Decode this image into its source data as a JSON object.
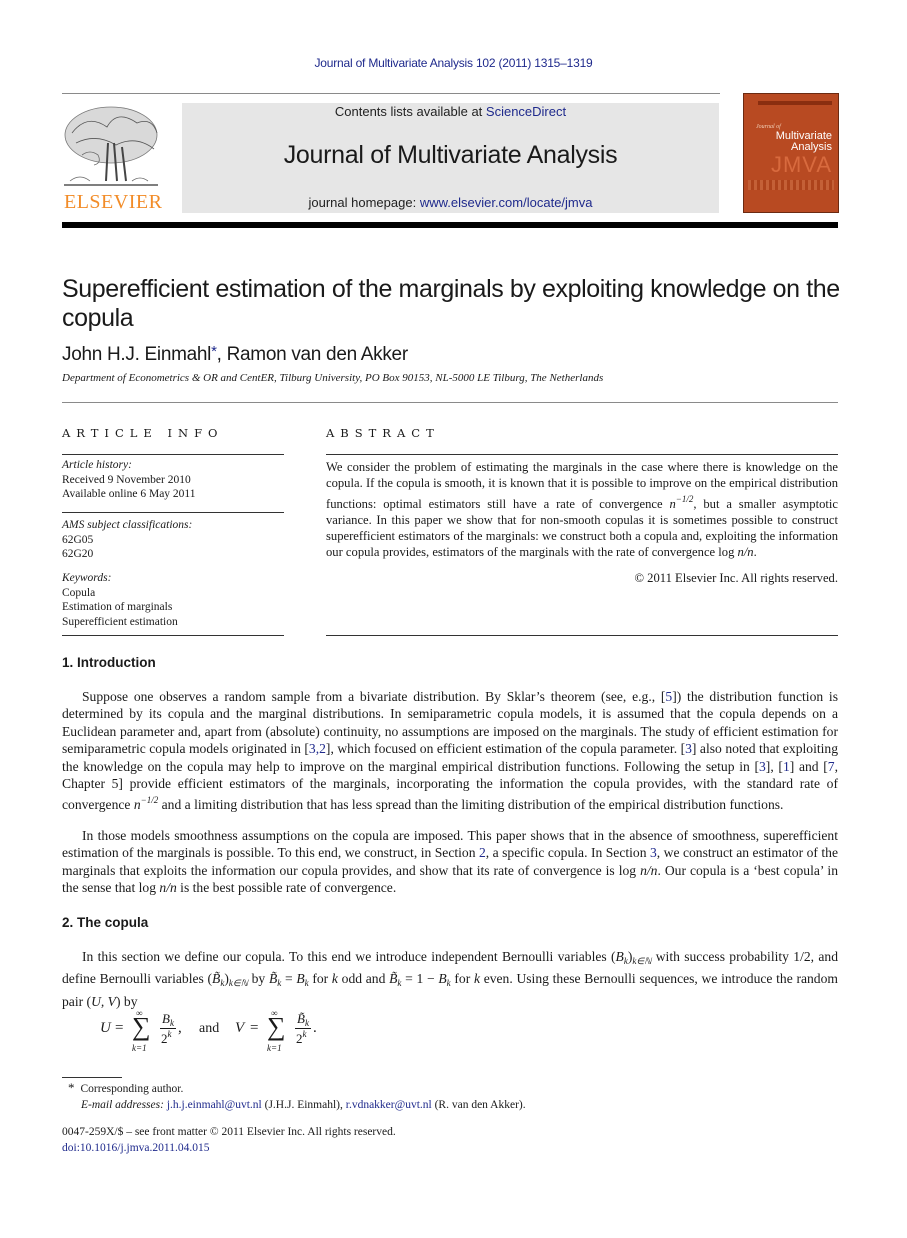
{
  "header": {
    "citation": "Journal of Multivariate Analysis 102 (2011) 1315–1319",
    "contents_prefix": "Contents lists available at ",
    "contents_link": "ScienceDirect",
    "journal_name": "Journal of Multivariate Analysis",
    "homepage_prefix": "journal homepage: ",
    "homepage_link": "www.elsevier.com/locate/jmva",
    "publisher": "ELSEVIER",
    "publisher_color": "#f28c28",
    "link_color": "#1f2a8c",
    "cover": {
      "small": "Journal of",
      "line1": "Multivariate",
      "line2": "Analysis",
      "acronym": "JMVA",
      "color": "#b84a22"
    }
  },
  "article": {
    "title": "Superefficient estimation of the marginals by exploiting knowledge on the copula",
    "authors": [
      {
        "name": "John H.J. Einmahl",
        "mark": "*"
      },
      {
        "name": "Ramon van den Akker",
        "mark": ""
      }
    ],
    "author_separator": ", ",
    "affiliation": "Department of Econometrics & OR and CentER, Tilburg University, PO Box 90153, NL-5000 LE Tilburg, The Netherlands"
  },
  "article_info": {
    "heading": "ARTICLE INFO",
    "history_label": "Article history:",
    "received": "Received 9 November 2010",
    "available": "Available online 6 May 2011",
    "ams_label": "AMS subject classifications:",
    "ams_codes": [
      "62G05",
      "62G20"
    ],
    "keywords_label": "Keywords:",
    "keywords": [
      "Copula",
      "Estimation of marginals",
      "Superefficient estimation"
    ]
  },
  "abstract": {
    "heading": "ABSTRACT",
    "p1": "We consider the problem of estimating the marginals in the case where there is knowledge on the copula. If the copula is smooth, it is known that it is possible to improve on the empirical distribution functions: optimal estimators still have a rate of convergence ",
    "rate1_base": "n",
    "rate1_exp": "−1/2",
    "p2": ", but a smaller asymptotic variance. In this paper we show that for non-smooth copulas it is sometimes possible to construct superefficient estimators of the marginals: we construct both a copula and, exploiting the information our copula provides, estimators of the marginals with the rate of convergence log ",
    "rate2": "n/n",
    "p3": ".",
    "copyright": "© 2011 Elsevier Inc. All rights reserved."
  },
  "sections": {
    "intro": {
      "heading": "1.  Introduction",
      "para1": [
        "Suppose one observes a random sample from a bivariate distribution. By Sklar’s theorem (see, e.g., [",
        "5",
        "]) the distribution function is determined by its copula and the marginal distributions. In semiparametric copula models, it is assumed that the copula depends on a Euclidean parameter and, apart from (absolute) continuity, no assumptions are imposed on the marginals. The study of efficient estimation for semiparametric copula models originated in [",
        "3,2",
        "], which focused on efficient estimation of the copula parameter. [",
        "3",
        "] also noted that exploiting the knowledge on the copula may help to improve on the marginal empirical distribution functions. Following the setup in [",
        "3",
        "], [",
        "1",
        "] and [",
        "7",
        ", Chapter 5] provide efficient estimators of the marginals, incorporating the information the copula provides, with the standard rate of convergence ",
        "n",
        "−1/2",
        " and a limiting distribution that has less spread than the limiting distribution of the empirical distribution functions."
      ],
      "para2": [
        "In those models smoothness assumptions on the copula are imposed. This paper shows that in the absence of smoothness, superefficient estimation of the marginals is possible. To this end, we construct, in Section ",
        "2",
        ", a specific copula. In Section ",
        "3",
        ", we construct an estimator of the marginals that exploits the information our copula provides, and show that its rate of convergence is log ",
        "n/n",
        ". Our copula is a ‘best copula’ in the sense that log ",
        "n/n",
        " is the best possible rate of convergence."
      ]
    },
    "copula": {
      "heading": "2.  The copula",
      "para": [
        "In this section we define our copula. To this end we introduce independent Bernoulli variables (",
        "B",
        "k",
        ")",
        "k∈ℕ",
        " with success probability 1/2, and define Bernoulli variables (",
        "B̃",
        "k",
        ")",
        "k∈ℕ",
        " by ",
        "B̃",
        "k",
        " = ",
        "B",
        "k",
        " for ",
        "k",
        " odd and ",
        "B̃",
        "k",
        " = 1 − ",
        "B",
        "k",
        " for ",
        "k",
        " even. Using these Bernoulli sequences, we introduce the random pair (",
        "U, V",
        ") by"
      ],
      "equation": {
        "lhs1": "U",
        "lhs2": "V",
        "eq": "=",
        "sum_upper": "∞",
        "sum_lower": "k=1",
        "num1": "B",
        "num2": "B̃",
        "num_sub": "k",
        "den": "2",
        "den_exp": "k",
        "connector": "and",
        "comma": ",",
        "period": "."
      }
    }
  },
  "footnotes": {
    "mark": "*",
    "corresponding": "Corresponding author.",
    "email_label": "E-mail addresses:",
    "email1": "j.h.j.einmahl@uvt.nl",
    "email1_owner": " (J.H.J. Einmahl), ",
    "email2": "r.vdnakker@uvt.nl",
    "email2_owner": " (R. van den Akker).",
    "issn_line": "0047-259X/$ – see front matter © 2011 Elsevier Inc. All rights reserved.",
    "doi": "doi:10.1016/j.jmva.2011.04.015"
  }
}
